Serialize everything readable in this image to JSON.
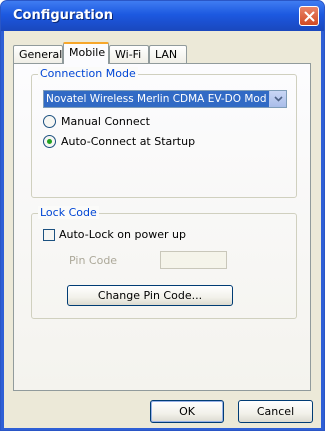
{
  "window": {
    "title": "Configuration"
  },
  "tabs": [
    {
      "label": "General",
      "active": false
    },
    {
      "label": "Mobile",
      "active": true
    },
    {
      "label": "Wi-Fi",
      "active": false
    },
    {
      "label": "LAN",
      "active": false
    }
  ],
  "connection_mode": {
    "legend": "Connection Mode",
    "device_selected": "Novatel Wireless Merlin CDMA EV-DO Modem",
    "options": [
      {
        "label": "Manual Connect",
        "checked": false
      },
      {
        "label": "Auto-Connect at Startup",
        "checked": true
      }
    ]
  },
  "lock_code": {
    "legend": "Lock Code",
    "auto_lock_label": "Auto-Lock on power up",
    "auto_lock_checked": false,
    "pin_code_label": "Pin Code",
    "pin_code_value": "",
    "change_pin_label": "Change Pin Code..."
  },
  "footer": {
    "ok_label": "OK",
    "cancel_label": "Cancel"
  },
  "colors": {
    "title_bar": "#1c59e0",
    "legend_text": "#0046d5",
    "tab_highlight": "#f7a72b",
    "close_button": "#d24a23"
  }
}
